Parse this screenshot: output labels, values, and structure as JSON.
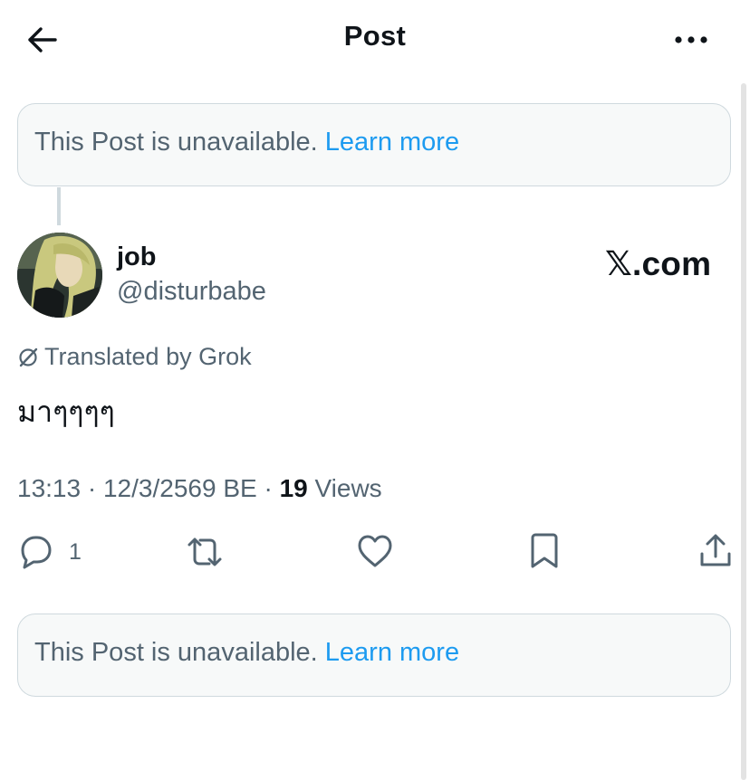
{
  "header": {
    "title": "Post",
    "back_icon": "arrow-left-icon",
    "more_icon": "more-horizontal-icon"
  },
  "notices": {
    "top": {
      "text": "This Post is unavailable.",
      "link": "Learn more"
    },
    "bottom": {
      "text": "This Post is unavailable.",
      "link": "Learn more"
    }
  },
  "author": {
    "display_name": "job",
    "handle": "@disturbabe",
    "avatar_icon": "avatar-image"
  },
  "source_logo": "𝕏.com",
  "translation": {
    "icon": "translate-slash-icon",
    "label": "Translated by Grok"
  },
  "post": {
    "text": "มาๆๆๆๆ"
  },
  "meta": {
    "time": "13:13",
    "separator": "·",
    "date": "12/3/2569 BE",
    "views_count": "19",
    "views_label": "Views"
  },
  "actions": {
    "reply_count": "1",
    "icons": [
      "reply-icon",
      "repost-icon",
      "like-icon",
      "bookmark-icon",
      "share-icon"
    ]
  },
  "colors": {
    "text": "#0f1419",
    "muted": "#536471",
    "link": "#1d9bf0",
    "border": "#cfd9de",
    "notice_bg": "#f7f9f9"
  }
}
